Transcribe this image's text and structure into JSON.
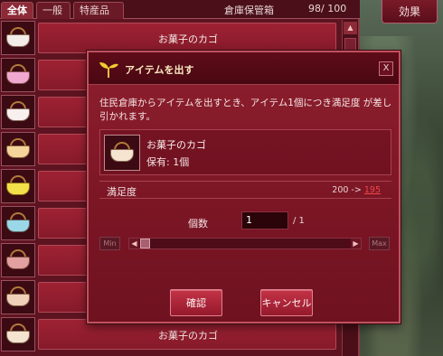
{
  "storage": {
    "tabs": [
      {
        "label": "全体",
        "active": true
      },
      {
        "label": "一般",
        "active": false
      },
      {
        "label": "特産品",
        "active": false
      }
    ],
    "title": "倉庫保管箱",
    "count": "98/ 100",
    "items": [
      {
        "name": "",
        "color": "#f4ece8"
      },
      {
        "name": "",
        "color": "#f1a8d0"
      },
      {
        "name": "",
        "color": "#f8f0ee"
      },
      {
        "name": "",
        "color": "#f4d49a"
      },
      {
        "name": "",
        "color": "#f4e048"
      },
      {
        "name": "",
        "color": "#9ad8e8"
      },
      {
        "name": "",
        "color": "#e2a0a0"
      },
      {
        "name": "",
        "color": "#f0d0b8"
      },
      {
        "name": "お菓子のカゴ",
        "color": "#f4e4d0"
      }
    ],
    "row1_name": "お菓子のカゴ"
  },
  "effect_button": "効果",
  "dialog": {
    "title": "アイテムを出す",
    "close": "X",
    "description": "住民倉庫からアイテムを出すとき、アイテム1個につき満足度 が差し引かれます。",
    "item_name": "お菓子のカゴ",
    "owned": "保有: 1個",
    "satisfaction_label": "満足度",
    "satisfaction_before": "200 ->",
    "satisfaction_after": "195",
    "quantity_label": "個数",
    "quantity_value": "1",
    "quantity_max": "/ 1",
    "slider_min": "Min",
    "slider_max": "Max",
    "slider_value": 0,
    "ok_button": "確認",
    "cancel_button": "キャンセル"
  }
}
